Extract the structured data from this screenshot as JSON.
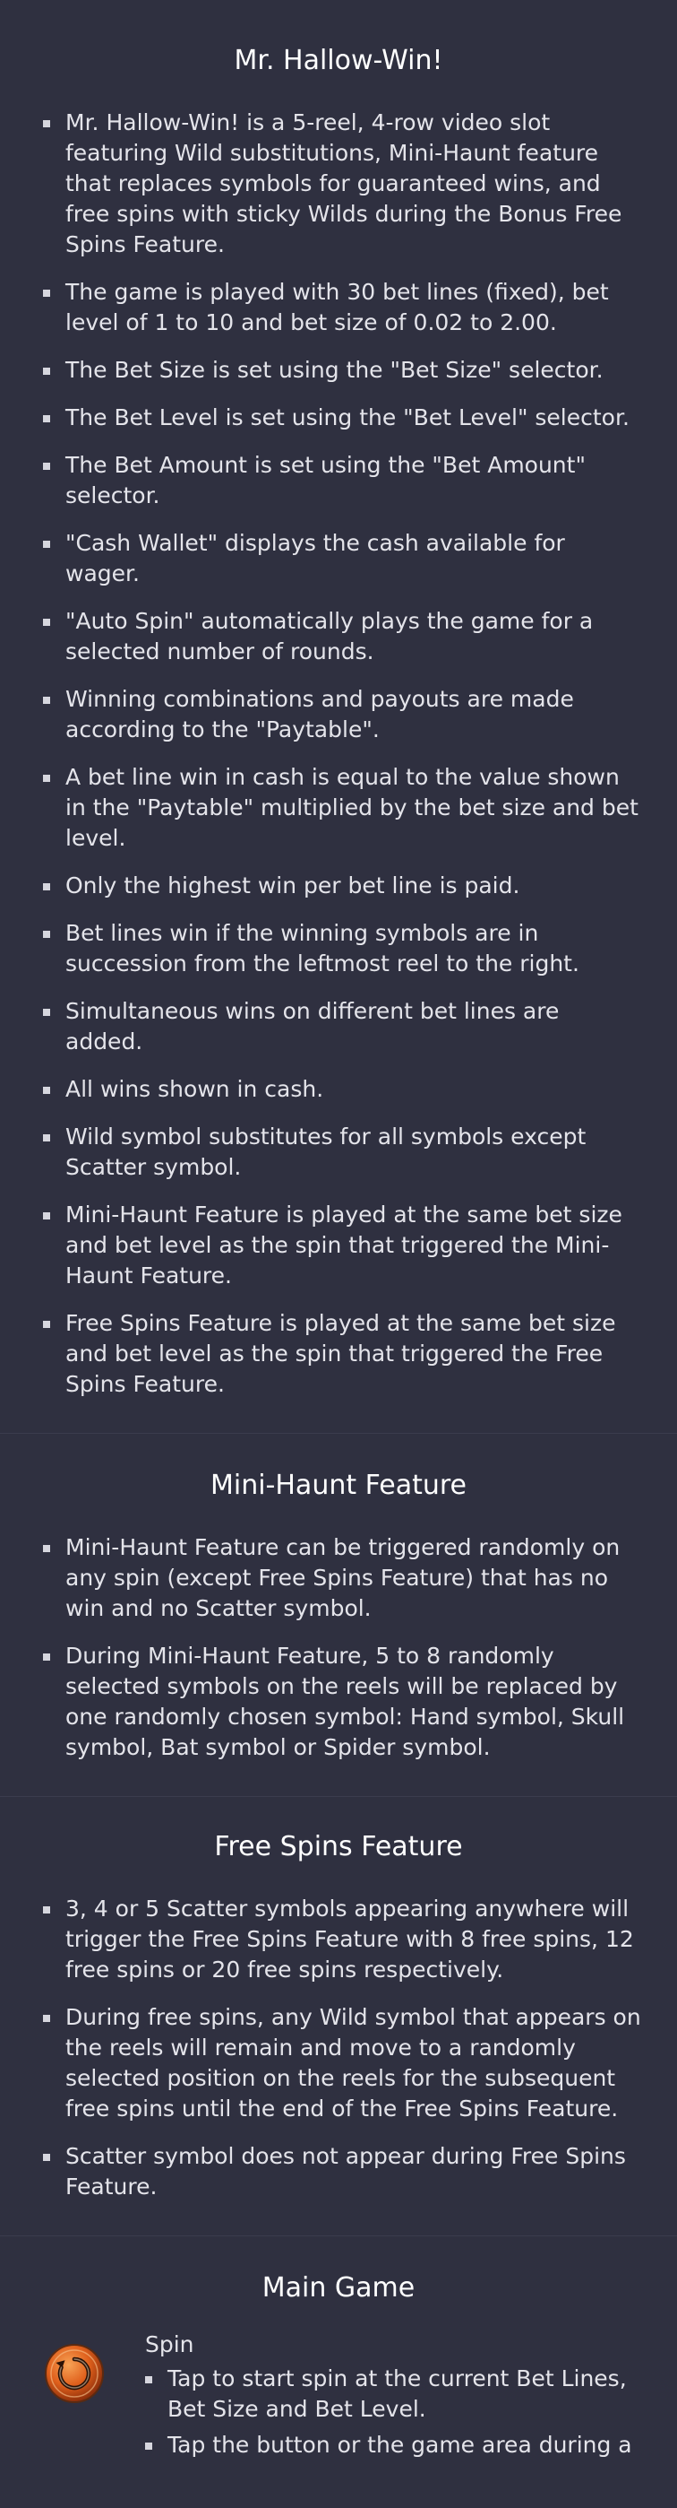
{
  "sections": [
    {
      "title": "Mr. Hallow-Win!",
      "items": [
        "Mr. Hallow-Win! is a 5-reel, 4-row video slot featuring Wild substitutions, Mini-Haunt feature that replaces symbols for guaranteed wins, and free spins with sticky Wilds during the Bonus Free Spins Feature.",
        "The game is played with 30 bet lines (fixed), bet level of 1 to 10 and bet size of 0.02 to 2.00.",
        "The Bet Size is set using the \"Bet Size\" selector.",
        "The Bet Level is set using the \"Bet Level\" selector.",
        "The Bet Amount is set using the \"Bet Amount\" selector.",
        "\"Cash Wallet\" displays the cash available for wager.",
        "\"Auto Spin\" automatically plays the game for a selected number of rounds.",
        "Winning combinations and payouts are made according to the \"Paytable\".",
        "A bet line win in cash is equal to the value shown in the \"Paytable\" multiplied by the bet size and bet level.",
        "Only the highest win per bet line is paid.",
        "Bet lines win if the winning symbols are in succession from the leftmost reel to the right.",
        "Simultaneous wins on different bet lines are added.",
        "All wins shown in cash.",
        "Wild symbol substitutes for all symbols except Scatter symbol.",
        "Mini-Haunt Feature is played at the same bet size and bet level as the spin that triggered the Mini-Haunt Feature.",
        "Free Spins Feature is played at the same bet size and bet level as the spin that triggered the Free Spins Feature."
      ]
    },
    {
      "title": "Mini-Haunt Feature",
      "items": [
        "Mini-Haunt Feature can be triggered randomly on any spin (except Free Spins Feature) that has no win and no Scatter symbol.",
        "During Mini-Haunt Feature, 5 to 8 randomly selected symbols on the reels will be replaced by one randomly chosen symbol: Hand symbol, Skull symbol, Bat symbol or Spider symbol."
      ]
    },
    {
      "title": "Free Spins Feature",
      "items": [
        "3, 4 or 5 Scatter symbols appearing anywhere will trigger the Free Spins Feature with 8 free spins, 12 free spins or 20 free spins respectively.",
        "During free spins, any Wild symbol that appears on the reels will remain and move to a randomly selected position on the reels for the subsequent free spins until the end of the Free Spins Feature.",
        "Scatter symbol does not appear during Free Spins Feature."
      ]
    }
  ],
  "main_game": {
    "title": "Main Game",
    "spin": {
      "icon": "spin-button-icon",
      "label": "Spin",
      "items": [
        "Tap to start spin at the current Bet Lines, Bet Size and Bet Level.",
        "Tap the button or the game area during a"
      ]
    }
  },
  "colors": {
    "background": "#2f3040",
    "divider": "#3b3c4d",
    "text": "#e4e4ea",
    "title": "#ffffff",
    "spin_button": "#e0601c"
  }
}
